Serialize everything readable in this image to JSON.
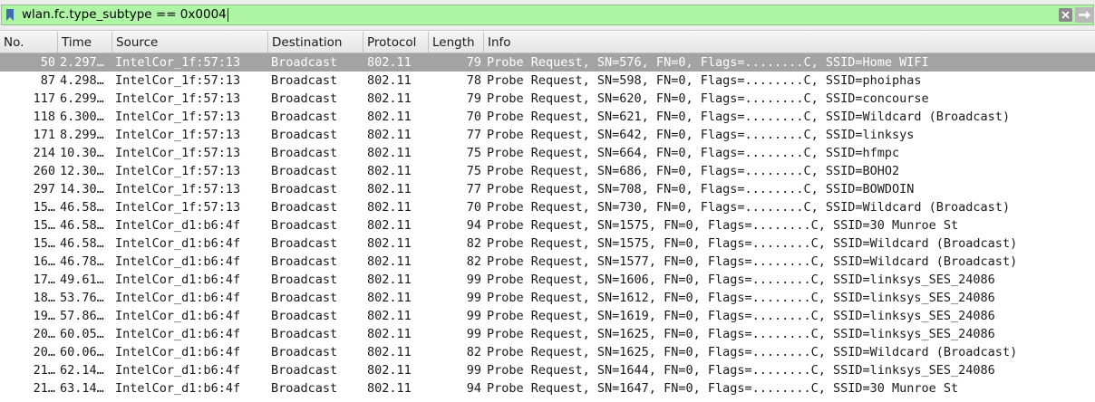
{
  "filter": {
    "value": "wlan.fc.type_subtype == 0x0004",
    "bookmark_icon": "bookmark-icon",
    "clear_icon": "clear-icon",
    "apply_icon": "arrow-right-icon"
  },
  "columns": [
    "No.",
    "Time",
    "Source",
    "Destination",
    "Protocol",
    "Length",
    "Info"
  ],
  "selected_row_index": 0,
  "colors": {
    "filter_valid": "#aff5a6",
    "selected_row": "#a3a3a3"
  },
  "rows": [
    {
      "no": "50",
      "time": "2.297…",
      "source": "IntelCor_1f:57:13",
      "destination": "Broadcast",
      "protocol": "802.11",
      "length": "79",
      "info": "Probe Request, SN=576, FN=0, Flags=........C, SSID=Home WIFI"
    },
    {
      "no": "87",
      "time": "4.298…",
      "source": "IntelCor_1f:57:13",
      "destination": "Broadcast",
      "protocol": "802.11",
      "length": "78",
      "info": "Probe Request, SN=598, FN=0, Flags=........C, SSID=phoiphas"
    },
    {
      "no": "117",
      "time": "6.299…",
      "source": "IntelCor_1f:57:13",
      "destination": "Broadcast",
      "protocol": "802.11",
      "length": "79",
      "info": "Probe Request, SN=620, FN=0, Flags=........C, SSID=concourse"
    },
    {
      "no": "118",
      "time": "6.300…",
      "source": "IntelCor_1f:57:13",
      "destination": "Broadcast",
      "protocol": "802.11",
      "length": "70",
      "info": "Probe Request, SN=621, FN=0, Flags=........C, SSID=Wildcard (Broadcast)"
    },
    {
      "no": "171",
      "time": "8.299…",
      "source": "IntelCor_1f:57:13",
      "destination": "Broadcast",
      "protocol": "802.11",
      "length": "77",
      "info": "Probe Request, SN=642, FN=0, Flags=........C, SSID=linksys"
    },
    {
      "no": "214",
      "time": "10.30…",
      "source": "IntelCor_1f:57:13",
      "destination": "Broadcast",
      "protocol": "802.11",
      "length": "75",
      "info": "Probe Request, SN=664, FN=0, Flags=........C, SSID=hfmpc"
    },
    {
      "no": "260",
      "time": "12.30…",
      "source": "IntelCor_1f:57:13",
      "destination": "Broadcast",
      "protocol": "802.11",
      "length": "75",
      "info": "Probe Request, SN=686, FN=0, Flags=........C, SSID=BOHO2"
    },
    {
      "no": "297",
      "time": "14.30…",
      "source": "IntelCor_1f:57:13",
      "destination": "Broadcast",
      "protocol": "802.11",
      "length": "77",
      "info": "Probe Request, SN=708, FN=0, Flags=........C, SSID=BOWDOIN"
    },
    {
      "no": "15…",
      "time": "46.58…",
      "source": "IntelCor_1f:57:13",
      "destination": "Broadcast",
      "protocol": "802.11",
      "length": "70",
      "info": "Probe Request, SN=730, FN=0, Flags=........C, SSID=Wildcard (Broadcast)"
    },
    {
      "no": "15…",
      "time": "46.58…",
      "source": "IntelCor_d1:b6:4f",
      "destination": "Broadcast",
      "protocol": "802.11",
      "length": "94",
      "info": "Probe Request, SN=1575, FN=0, Flags=........C, SSID=30 Munroe St"
    },
    {
      "no": "15…",
      "time": "46.58…",
      "source": "IntelCor_d1:b6:4f",
      "destination": "Broadcast",
      "protocol": "802.11",
      "length": "82",
      "info": "Probe Request, SN=1575, FN=0, Flags=........C, SSID=Wildcard (Broadcast)"
    },
    {
      "no": "16…",
      "time": "46.78…",
      "source": "IntelCor_d1:b6:4f",
      "destination": "Broadcast",
      "protocol": "802.11",
      "length": "82",
      "info": "Probe Request, SN=1577, FN=0, Flags=........C, SSID=Wildcard (Broadcast)"
    },
    {
      "no": "17…",
      "time": "49.61…",
      "source": "IntelCor_d1:b6:4f",
      "destination": "Broadcast",
      "protocol": "802.11",
      "length": "99",
      "info": "Probe Request, SN=1606, FN=0, Flags=........C, SSID=linksys_SES_24086"
    },
    {
      "no": "18…",
      "time": "53.76…",
      "source": "IntelCor_d1:b6:4f",
      "destination": "Broadcast",
      "protocol": "802.11",
      "length": "99",
      "info": "Probe Request, SN=1612, FN=0, Flags=........C, SSID=linksys_SES_24086"
    },
    {
      "no": "19…",
      "time": "57.86…",
      "source": "IntelCor_d1:b6:4f",
      "destination": "Broadcast",
      "protocol": "802.11",
      "length": "99",
      "info": "Probe Request, SN=1619, FN=0, Flags=........C, SSID=linksys_SES_24086"
    },
    {
      "no": "20…",
      "time": "60.05…",
      "source": "IntelCor_d1:b6:4f",
      "destination": "Broadcast",
      "protocol": "802.11",
      "length": "99",
      "info": "Probe Request, SN=1625, FN=0, Flags=........C, SSID=linksys_SES_24086"
    },
    {
      "no": "20…",
      "time": "60.06…",
      "source": "IntelCor_d1:b6:4f",
      "destination": "Broadcast",
      "protocol": "802.11",
      "length": "82",
      "info": "Probe Request, SN=1625, FN=0, Flags=........C, SSID=Wildcard (Broadcast)"
    },
    {
      "no": "21…",
      "time": "62.14…",
      "source": "IntelCor_d1:b6:4f",
      "destination": "Broadcast",
      "protocol": "802.11",
      "length": "99",
      "info": "Probe Request, SN=1644, FN=0, Flags=........C, SSID=linksys_SES_24086"
    },
    {
      "no": "21…",
      "time": "63.14…",
      "source": "IntelCor_d1:b6:4f",
      "destination": "Broadcast",
      "protocol": "802.11",
      "length": "94",
      "info": "Probe Request, SN=1647, FN=0, Flags=........C, SSID=30 Munroe St"
    }
  ]
}
